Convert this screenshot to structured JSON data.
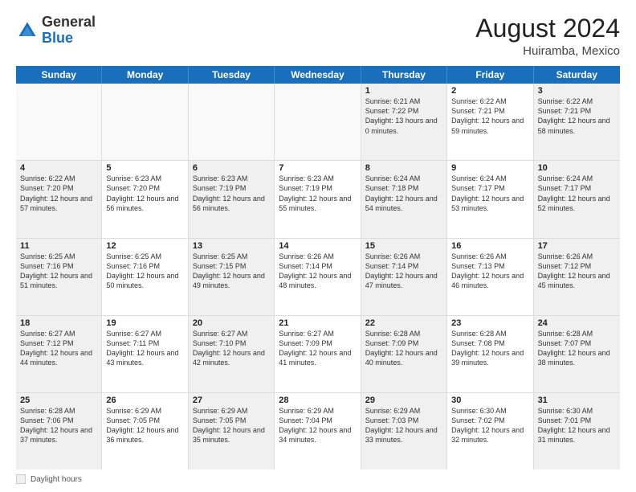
{
  "logo": {
    "general": "General",
    "blue": "Blue"
  },
  "title": "August 2024",
  "location": "Huiramba, Mexico",
  "days_header": [
    "Sunday",
    "Monday",
    "Tuesday",
    "Wednesday",
    "Thursday",
    "Friday",
    "Saturday"
  ],
  "footer_label": "Daylight hours",
  "weeks": [
    [
      {
        "day": "",
        "sunrise": "",
        "sunset": "",
        "daylight": "",
        "empty": true
      },
      {
        "day": "",
        "sunrise": "",
        "sunset": "",
        "daylight": "",
        "empty": true
      },
      {
        "day": "",
        "sunrise": "",
        "sunset": "",
        "daylight": "",
        "empty": true
      },
      {
        "day": "",
        "sunrise": "",
        "sunset": "",
        "daylight": "",
        "empty": true
      },
      {
        "day": "1",
        "sunrise": "Sunrise: 6:21 AM",
        "sunset": "Sunset: 7:22 PM",
        "daylight": "Daylight: 13 hours and 0 minutes."
      },
      {
        "day": "2",
        "sunrise": "Sunrise: 6:22 AM",
        "sunset": "Sunset: 7:21 PM",
        "daylight": "Daylight: 12 hours and 59 minutes."
      },
      {
        "day": "3",
        "sunrise": "Sunrise: 6:22 AM",
        "sunset": "Sunset: 7:21 PM",
        "daylight": "Daylight: 12 hours and 58 minutes."
      }
    ],
    [
      {
        "day": "4",
        "sunrise": "Sunrise: 6:22 AM",
        "sunset": "Sunset: 7:20 PM",
        "daylight": "Daylight: 12 hours and 57 minutes."
      },
      {
        "day": "5",
        "sunrise": "Sunrise: 6:23 AM",
        "sunset": "Sunset: 7:20 PM",
        "daylight": "Daylight: 12 hours and 56 minutes."
      },
      {
        "day": "6",
        "sunrise": "Sunrise: 6:23 AM",
        "sunset": "Sunset: 7:19 PM",
        "daylight": "Daylight: 12 hours and 56 minutes."
      },
      {
        "day": "7",
        "sunrise": "Sunrise: 6:23 AM",
        "sunset": "Sunset: 7:19 PM",
        "daylight": "Daylight: 12 hours and 55 minutes."
      },
      {
        "day": "8",
        "sunrise": "Sunrise: 6:24 AM",
        "sunset": "Sunset: 7:18 PM",
        "daylight": "Daylight: 12 hours and 54 minutes."
      },
      {
        "day": "9",
        "sunrise": "Sunrise: 6:24 AM",
        "sunset": "Sunset: 7:17 PM",
        "daylight": "Daylight: 12 hours and 53 minutes."
      },
      {
        "day": "10",
        "sunrise": "Sunrise: 6:24 AM",
        "sunset": "Sunset: 7:17 PM",
        "daylight": "Daylight: 12 hours and 52 minutes."
      }
    ],
    [
      {
        "day": "11",
        "sunrise": "Sunrise: 6:25 AM",
        "sunset": "Sunset: 7:16 PM",
        "daylight": "Daylight: 12 hours and 51 minutes."
      },
      {
        "day": "12",
        "sunrise": "Sunrise: 6:25 AM",
        "sunset": "Sunset: 7:16 PM",
        "daylight": "Daylight: 12 hours and 50 minutes."
      },
      {
        "day": "13",
        "sunrise": "Sunrise: 6:25 AM",
        "sunset": "Sunset: 7:15 PM",
        "daylight": "Daylight: 12 hours and 49 minutes."
      },
      {
        "day": "14",
        "sunrise": "Sunrise: 6:26 AM",
        "sunset": "Sunset: 7:14 PM",
        "daylight": "Daylight: 12 hours and 48 minutes."
      },
      {
        "day": "15",
        "sunrise": "Sunrise: 6:26 AM",
        "sunset": "Sunset: 7:14 PM",
        "daylight": "Daylight: 12 hours and 47 minutes."
      },
      {
        "day": "16",
        "sunrise": "Sunrise: 6:26 AM",
        "sunset": "Sunset: 7:13 PM",
        "daylight": "Daylight: 12 hours and 46 minutes."
      },
      {
        "day": "17",
        "sunrise": "Sunrise: 6:26 AM",
        "sunset": "Sunset: 7:12 PM",
        "daylight": "Daylight: 12 hours and 45 minutes."
      }
    ],
    [
      {
        "day": "18",
        "sunrise": "Sunrise: 6:27 AM",
        "sunset": "Sunset: 7:12 PM",
        "daylight": "Daylight: 12 hours and 44 minutes."
      },
      {
        "day": "19",
        "sunrise": "Sunrise: 6:27 AM",
        "sunset": "Sunset: 7:11 PM",
        "daylight": "Daylight: 12 hours and 43 minutes."
      },
      {
        "day": "20",
        "sunrise": "Sunrise: 6:27 AM",
        "sunset": "Sunset: 7:10 PM",
        "daylight": "Daylight: 12 hours and 42 minutes."
      },
      {
        "day": "21",
        "sunrise": "Sunrise: 6:27 AM",
        "sunset": "Sunset: 7:09 PM",
        "daylight": "Daylight: 12 hours and 41 minutes."
      },
      {
        "day": "22",
        "sunrise": "Sunrise: 6:28 AM",
        "sunset": "Sunset: 7:09 PM",
        "daylight": "Daylight: 12 hours and 40 minutes."
      },
      {
        "day": "23",
        "sunrise": "Sunrise: 6:28 AM",
        "sunset": "Sunset: 7:08 PM",
        "daylight": "Daylight: 12 hours and 39 minutes."
      },
      {
        "day": "24",
        "sunrise": "Sunrise: 6:28 AM",
        "sunset": "Sunset: 7:07 PM",
        "daylight": "Daylight: 12 hours and 38 minutes."
      }
    ],
    [
      {
        "day": "25",
        "sunrise": "Sunrise: 6:28 AM",
        "sunset": "Sunset: 7:06 PM",
        "daylight": "Daylight: 12 hours and 37 minutes."
      },
      {
        "day": "26",
        "sunrise": "Sunrise: 6:29 AM",
        "sunset": "Sunset: 7:05 PM",
        "daylight": "Daylight: 12 hours and 36 minutes."
      },
      {
        "day": "27",
        "sunrise": "Sunrise: 6:29 AM",
        "sunset": "Sunset: 7:05 PM",
        "daylight": "Daylight: 12 hours and 35 minutes."
      },
      {
        "day": "28",
        "sunrise": "Sunrise: 6:29 AM",
        "sunset": "Sunset: 7:04 PM",
        "daylight": "Daylight: 12 hours and 34 minutes."
      },
      {
        "day": "29",
        "sunrise": "Sunrise: 6:29 AM",
        "sunset": "Sunset: 7:03 PM",
        "daylight": "Daylight: 12 hours and 33 minutes."
      },
      {
        "day": "30",
        "sunrise": "Sunrise: 6:30 AM",
        "sunset": "Sunset: 7:02 PM",
        "daylight": "Daylight: 12 hours and 32 minutes."
      },
      {
        "day": "31",
        "sunrise": "Sunrise: 6:30 AM",
        "sunset": "Sunset: 7:01 PM",
        "daylight": "Daylight: 12 hours and 31 minutes."
      }
    ]
  ]
}
